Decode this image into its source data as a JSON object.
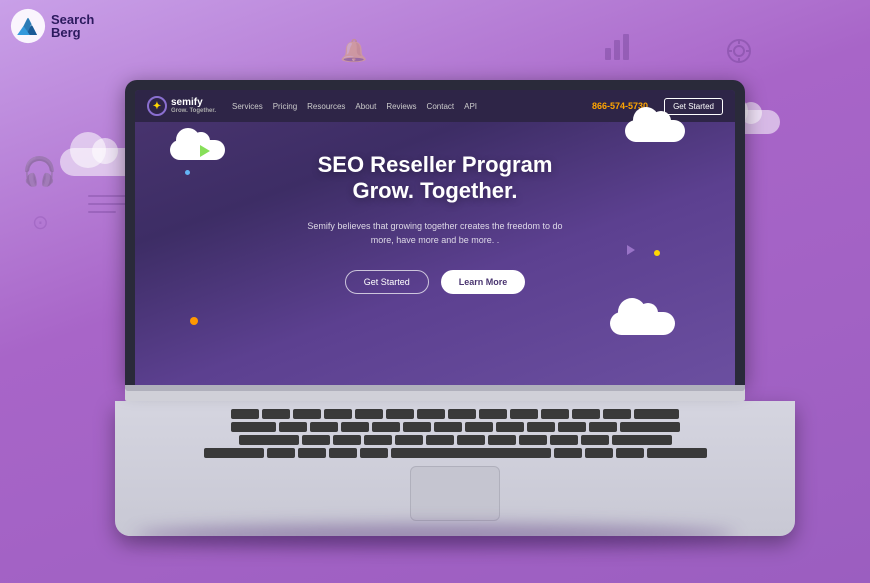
{
  "logo": {
    "brand": "Search Berg",
    "search_text": "Search",
    "berg_text": "Berg"
  },
  "background": {
    "color": "#b47ed4"
  },
  "semify": {
    "name": "semify",
    "tagline": "Grow. Together.",
    "nav_links": [
      "Services",
      "Pricing",
      "Resources",
      "About",
      "Reviews",
      "Contact",
      "API"
    ],
    "phone": "866-574-5730",
    "cta_button": "Get Started"
  },
  "hero": {
    "title_line1": "SEO Reseller Program",
    "title_line2": "Grow. Together.",
    "subtitle": "Semify believes that growing together creates the freedom to do more, have more and be more. .",
    "button_primary": "Get Started",
    "button_secondary": "Learn More"
  }
}
